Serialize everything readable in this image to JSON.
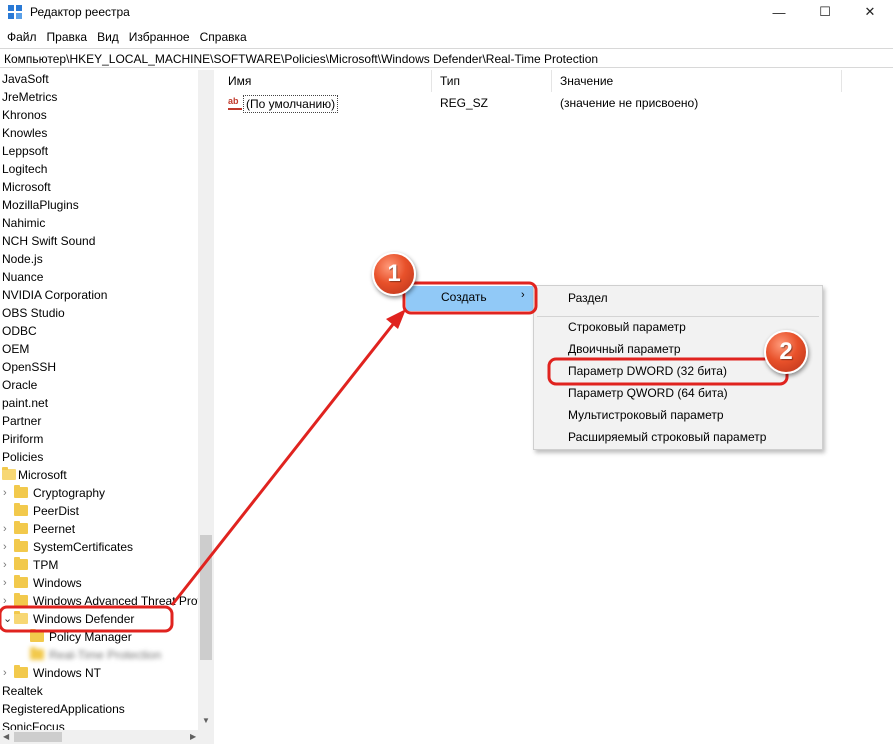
{
  "window": {
    "title": "Редактор реестра",
    "minimize_glyph": "—",
    "maximize_glyph": "☐",
    "close_glyph": "✕"
  },
  "menu": [
    "Файл",
    "Правка",
    "Вид",
    "Избранное",
    "Справка"
  ],
  "address": "Компьютер\\HKEY_LOCAL_MACHINE\\SOFTWARE\\Policies\\Microsoft\\Windows Defender\\Real-Time Protection",
  "tree": {
    "items": [
      {
        "label": "JavaSoft"
      },
      {
        "label": "JreMetrics"
      },
      {
        "label": "Khronos"
      },
      {
        "label": "Knowles"
      },
      {
        "label": "Leppsoft"
      },
      {
        "label": "Logitech"
      },
      {
        "label": "Microsoft"
      },
      {
        "label": "MozillaPlugins"
      },
      {
        "label": "Nahimic"
      },
      {
        "label": "NCH Swift Sound"
      },
      {
        "label": "Node.js"
      },
      {
        "label": "Nuance"
      },
      {
        "label": "NVIDIA Corporation"
      },
      {
        "label": "OBS Studio"
      },
      {
        "label": "ODBC"
      },
      {
        "label": "OEM"
      },
      {
        "label": "OpenSSH"
      },
      {
        "label": "Oracle"
      },
      {
        "label": "paint.net"
      },
      {
        "label": "Partner"
      },
      {
        "label": "Piriform"
      },
      {
        "label": "Policies"
      },
      {
        "label": "Microsoft"
      },
      {
        "label": "Cryptography"
      },
      {
        "label": "PeerDist"
      },
      {
        "label": "Peernet"
      },
      {
        "label": "SystemCertificates"
      },
      {
        "label": "TPM"
      },
      {
        "label": "Windows"
      },
      {
        "label": "Windows Advanced Threat Prot"
      },
      {
        "label": "Windows Defender"
      },
      {
        "label": "Policy Manager"
      },
      {
        "label": "Real-Time Protection"
      },
      {
        "label": "Windows NT"
      },
      {
        "label": "Realtek"
      },
      {
        "label": "RegisteredApplications"
      },
      {
        "label": "SonicFocus"
      }
    ]
  },
  "list": {
    "columns": [
      "Имя",
      "Тип",
      "Значение"
    ],
    "rows": [
      {
        "name": "(По умолчанию)",
        "type": "REG_SZ",
        "value": "(значение не присвоено)"
      }
    ]
  },
  "context_menu": {
    "create_label": "Создать",
    "submenu_arrow": "›",
    "submenu": [
      "Раздел",
      "Строковый параметр",
      "Двоичный параметр",
      "Параметр DWORD (32 бита)",
      "Параметр QWORD (64 бита)",
      "Мультистроковый параметр",
      "Расширяемый строковый параметр"
    ]
  },
  "annotations": {
    "badge1": "1",
    "badge2": "2",
    "color": "#e0231f"
  },
  "icons": {
    "value_icon": "ab",
    "chevron_collapsed": "›",
    "chevron_expanded": "⌄"
  }
}
